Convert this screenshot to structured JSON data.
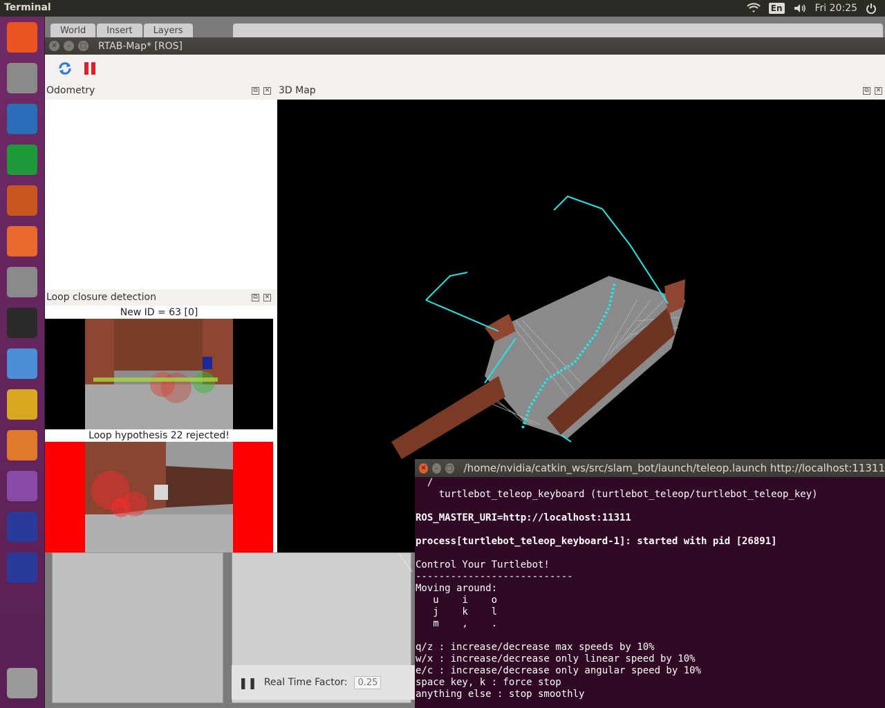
{
  "topbar": {
    "app_title": "Terminal",
    "keyboard": "En",
    "clock": "Fri 20:25",
    "icons": [
      "wifi-icon",
      "keyboard-layout-icon",
      "volume-icon",
      "power-icon"
    ]
  },
  "launcher": {
    "items": [
      {
        "name": "ubuntu-dash-icon",
        "color": "#e95420"
      },
      {
        "name": "files-icon",
        "color": "#8a8a8a"
      },
      {
        "name": "writer-icon",
        "color": "#2a6eb8"
      },
      {
        "name": "calc-icon",
        "color": "#1f9a3a"
      },
      {
        "name": "impress-icon",
        "color": "#c8561e"
      },
      {
        "name": "software-center-icon",
        "color": "#e8692b"
      },
      {
        "name": "system-settings-icon",
        "color": "#8a8a8a"
      },
      {
        "name": "terminal-icon",
        "color": "#2b2b2b"
      },
      {
        "name": "chromium-icon",
        "color": "#4a8fd6"
      },
      {
        "name": "teapot-icon",
        "color": "#d8a820"
      },
      {
        "name": "gazebo-icon",
        "color": "#e07a2a"
      },
      {
        "name": "rqt-graph-icon",
        "color": "#8a4aa8"
      },
      {
        "name": "rviz-icon-1",
        "color": "#2a3a9a"
      },
      {
        "name": "rviz-icon-2",
        "color": "#2a3a9a"
      },
      {
        "name": "trash-icon",
        "color": "#9a9a9a"
      }
    ]
  },
  "gazebo": {
    "tabs": [
      "World",
      "Insert",
      "Layers"
    ],
    "rtf_label": "Real Time Factor:",
    "rtf_value": "0.25"
  },
  "rtabmap": {
    "title": "RTAB-Map* [ROS]",
    "odometry_title": "Odometry",
    "loop_title": "Loop closure detection",
    "map_title": "3D Map",
    "new_id": "New ID = 63 [0]",
    "loop_hypothesis": "Loop hypothesis 22 rejected!"
  },
  "terminal": {
    "title": "/home/nvidia/catkin_ws/src/slam_bot/launch/teleop.launch http://localhost:11311",
    "lines": [
      {
        "text": "  /",
        "bold": false
      },
      {
        "text": "    turtlebot_teleop_keyboard (turtlebot_teleop/turtlebot_teleop_key)",
        "bold": false
      },
      {
        "text": "",
        "bold": false
      },
      {
        "text": "ROS_MASTER_URI=http://localhost:11311",
        "bold": true
      },
      {
        "text": "",
        "bold": false
      },
      {
        "text": "process[turtlebot_teleop_keyboard-1]: started with pid [26891]",
        "bold": true
      },
      {
        "text": "",
        "bold": false
      },
      {
        "text": "Control Your Turtlebot!",
        "bold": false
      },
      {
        "text": "---------------------------",
        "bold": false
      },
      {
        "text": "Moving around:",
        "bold": false
      },
      {
        "text": "   u    i    o",
        "bold": false
      },
      {
        "text": "   j    k    l",
        "bold": false
      },
      {
        "text": "   m    ,    .",
        "bold": false
      },
      {
        "text": "",
        "bold": false
      },
      {
        "text": "q/z : increase/decrease max speeds by 10%",
        "bold": false
      },
      {
        "text": "w/x : increase/decrease only linear speed by 10%",
        "bold": false
      },
      {
        "text": "e/c : increase/decrease only angular speed by 10%",
        "bold": false
      },
      {
        "text": "space key, k : force stop",
        "bold": false
      },
      {
        "text": "anything else : stop smoothly",
        "bold": false
      }
    ]
  }
}
